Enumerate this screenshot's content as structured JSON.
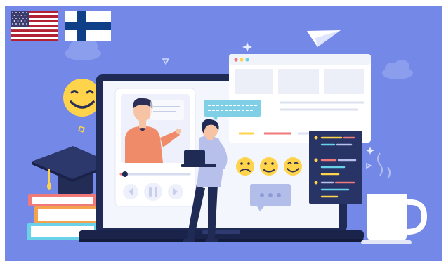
{
  "languages": [
    {
      "code": "en-US",
      "flag": "us-flag",
      "selected": true
    },
    {
      "code": "fi",
      "flag": "fi-flag",
      "selected": false
    }
  ],
  "illustration": {
    "subject": "online-learning",
    "caption": "",
    "colors": {
      "background": "#6f84e6",
      "laptop": "#1f2a55",
      "screen": "#f4f6fd",
      "accent_orange": "#f08b6a",
      "accent_yellow": "#ffd34a",
      "chat_bubble": "#7fd0e6",
      "code_panel": "#283366"
    },
    "video_player": {
      "progress": 0.06
    },
    "emoji_rating": {
      "faces": [
        "sad-face-icon",
        "neutral-face-icon",
        "happy-face-icon"
      ]
    }
  }
}
